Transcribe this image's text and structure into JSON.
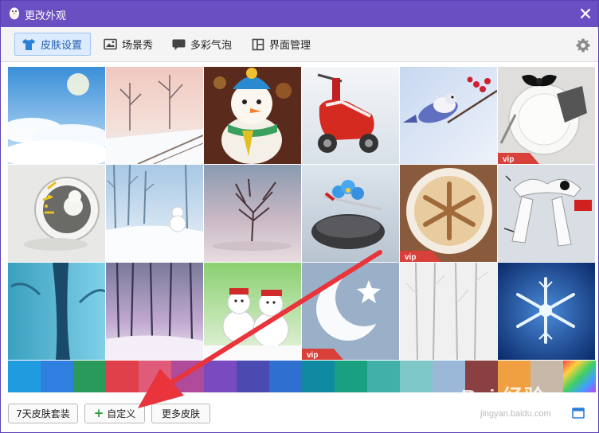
{
  "window": {
    "title": "更改外观",
    "accent_color": "#6a4fc2"
  },
  "tabs": [
    {
      "label": "皮肤设置",
      "icon": "shirt-icon",
      "active": true
    },
    {
      "label": "场景秀",
      "icon": "picture-icon",
      "active": false
    },
    {
      "label": "多彩气泡",
      "icon": "chat-bubble-icon",
      "active": false
    },
    {
      "label": "界面管理",
      "icon": "layout-icon",
      "active": false
    }
  ],
  "skins": [
    {
      "row": 0,
      "col": 0,
      "theme": "sky-clouds",
      "vip": false
    },
    {
      "row": 0,
      "col": 1,
      "theme": "winter-bridge",
      "vip": false
    },
    {
      "row": 0,
      "col": 2,
      "theme": "snowman-toy",
      "vip": false
    },
    {
      "row": 0,
      "col": 3,
      "theme": "red-scooter",
      "vip": false
    },
    {
      "row": 0,
      "col": 4,
      "theme": "bird-berries",
      "vip": false
    },
    {
      "row": 0,
      "col": 5,
      "theme": "plate-bowtie",
      "vip": true
    },
    {
      "row": 1,
      "col": 0,
      "theme": "snow-globe",
      "vip": false
    },
    {
      "row": 1,
      "col": 1,
      "theme": "snowy-forest",
      "vip": false
    },
    {
      "row": 1,
      "col": 2,
      "theme": "lonely-tree",
      "vip": false
    },
    {
      "row": 1,
      "col": 3,
      "theme": "stones-flowers",
      "vip": false
    },
    {
      "row": 1,
      "col": 4,
      "theme": "latte-snowflake",
      "vip": true
    },
    {
      "row": 1,
      "col": 5,
      "theme": "scarf-doodle",
      "vip": false
    },
    {
      "row": 2,
      "col": 0,
      "theme": "blue-trunk",
      "vip": false
    },
    {
      "row": 2,
      "col": 1,
      "theme": "purple-woods",
      "vip": false
    },
    {
      "row": 2,
      "col": 2,
      "theme": "snowmen-couple",
      "vip": false
    },
    {
      "row": 2,
      "col": 3,
      "theme": "moon-star",
      "vip": true
    },
    {
      "row": 2,
      "col": 4,
      "theme": "white-forest",
      "vip": false
    },
    {
      "row": 2,
      "col": 5,
      "theme": "ice-snowflake",
      "vip": false
    }
  ],
  "vip_label": "vip",
  "colors": [
    "#1f9be0",
    "#2f7fe0",
    "#2a9a5c",
    "#e0404a",
    "#e05a7a",
    "#b04a9a",
    "#7a4ac0",
    "#4a4ab0",
    "#2f6fd0",
    "#0f8aa0",
    "#18a080",
    "#40b0a8",
    "#7ec8c8",
    "#9cb8d8",
    "#8a4040",
    "#f0a040",
    "#c8b8a8",
    "rainbow"
  ],
  "footer": {
    "suit_button": "7天皮肤套装",
    "custom_button": "自定义",
    "more_button": "更多皮肤"
  },
  "watermark": {
    "line1": "Bai 经验",
    "line2": "jingyan.baidu.com"
  }
}
